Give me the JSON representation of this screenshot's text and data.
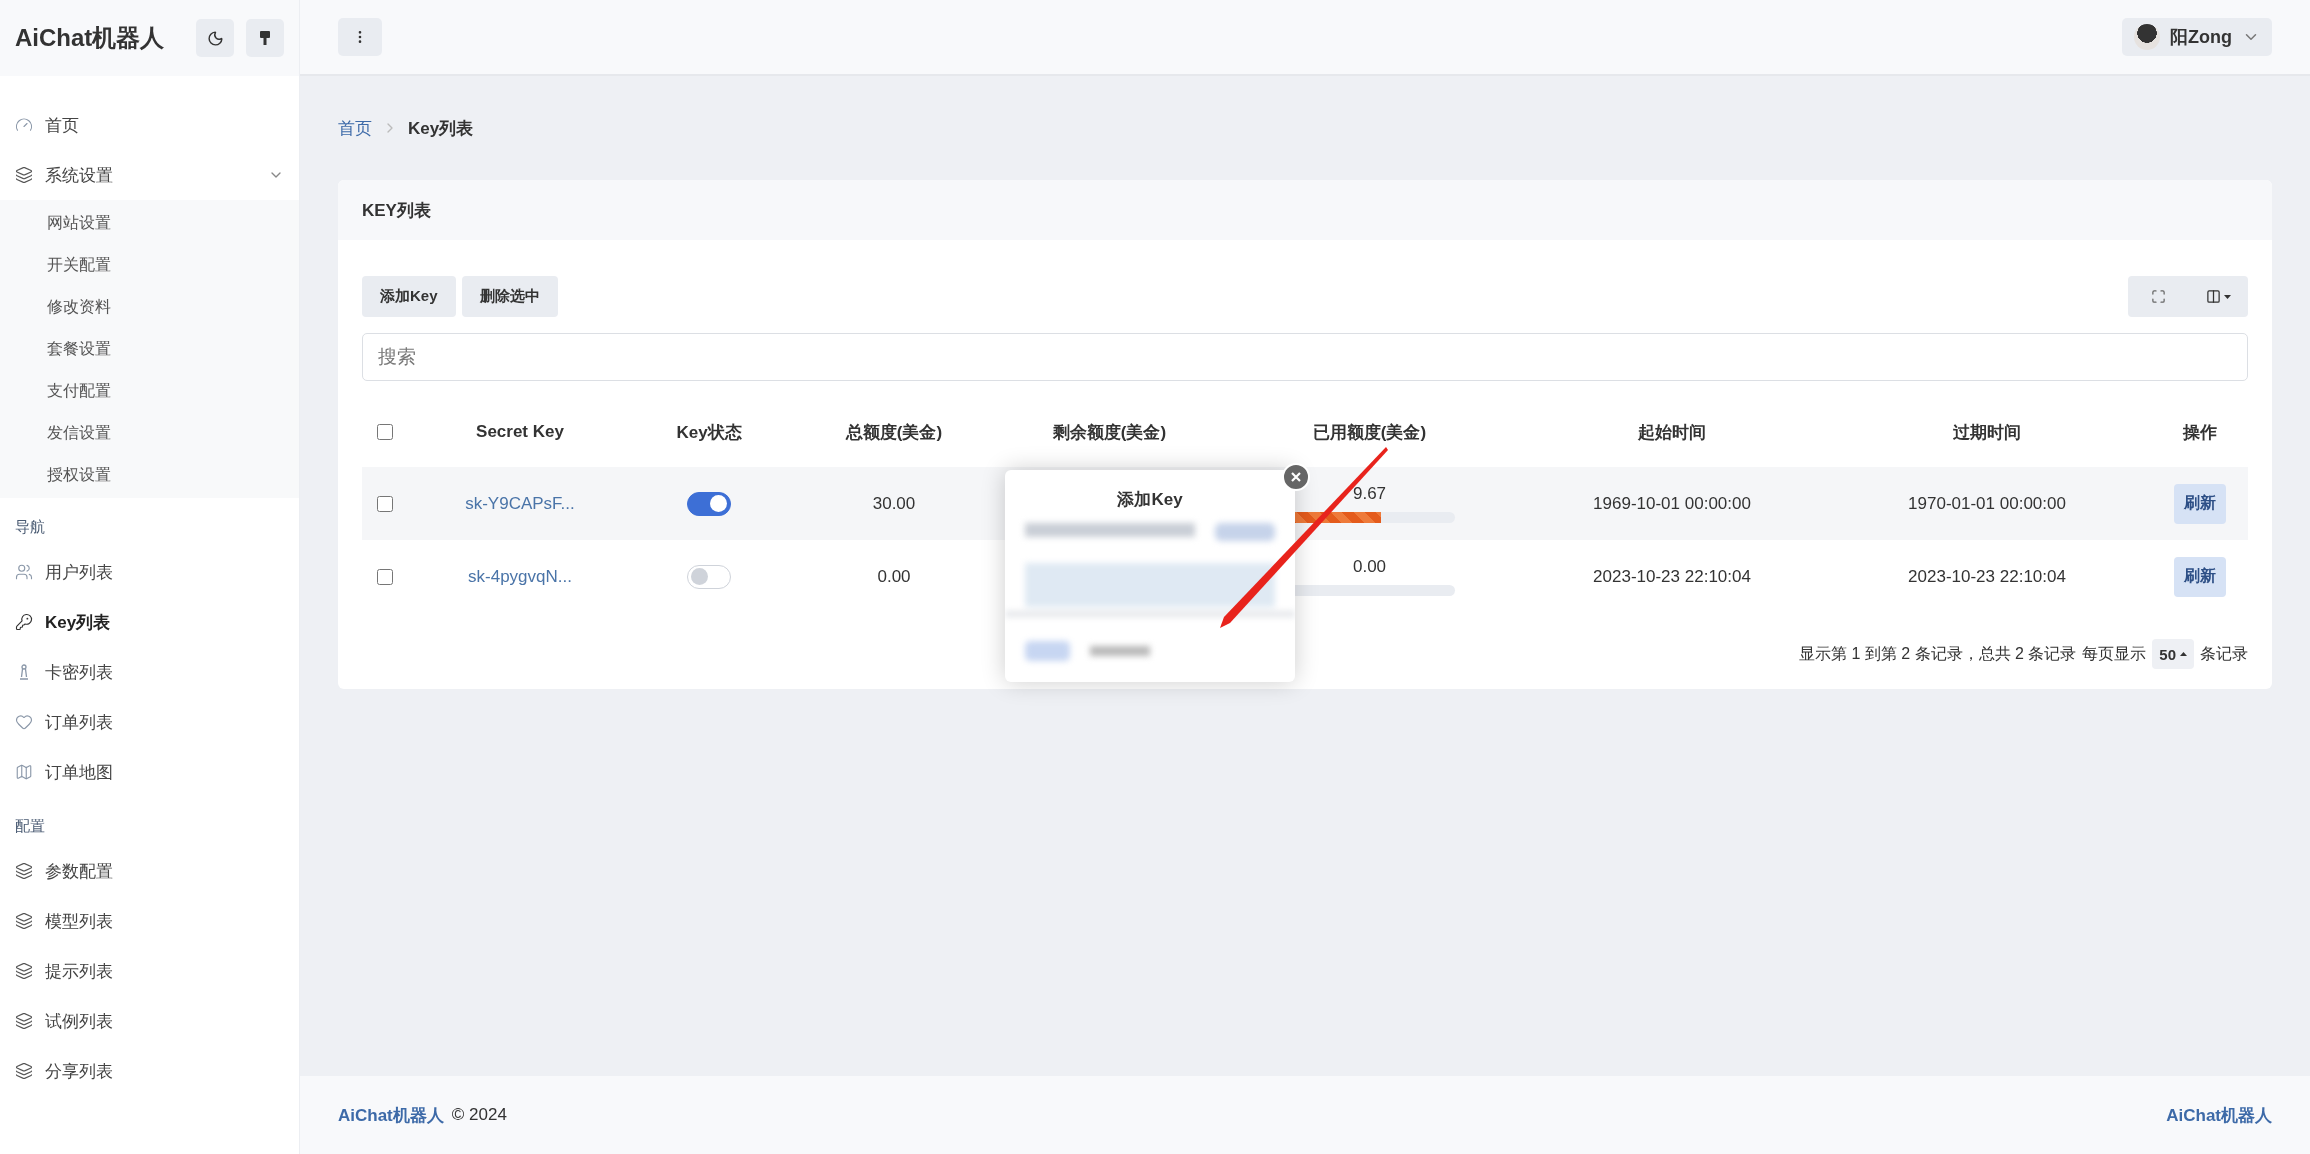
{
  "brand": "AiChat机器人",
  "sidebar": {
    "sections": [
      {
        "items": [
          {
            "label": "首页",
            "kind": "gauge",
            "selected": false
          },
          {
            "label": "系统设置",
            "kind": "layers",
            "selected": false,
            "expanded": true,
            "children": [
              {
                "label": "网站设置",
                "selected": false
              },
              {
                "label": "开关配置",
                "selected": false
              },
              {
                "label": "修改资料",
                "selected": false
              },
              {
                "label": "套餐设置",
                "selected": false
              },
              {
                "label": "支付配置",
                "selected": false
              },
              {
                "label": "发信设置",
                "selected": false
              },
              {
                "label": "授权设置",
                "selected": false
              }
            ]
          }
        ]
      },
      {
        "title": "导航",
        "items": [
          {
            "label": "用户列表",
            "kind": "users",
            "selected": false
          },
          {
            "label": "Key列表",
            "kind": "key",
            "selected": true
          },
          {
            "label": "卡密列表",
            "kind": "pawn",
            "selected": false
          },
          {
            "label": "订单列表",
            "kind": "heart",
            "selected": false
          },
          {
            "label": "订单地图",
            "kind": "map",
            "selected": false
          }
        ]
      },
      {
        "title": "配置",
        "items": [
          {
            "label": "参数配置",
            "kind": "layers",
            "selected": false
          },
          {
            "label": "模型列表",
            "kind": "layers",
            "selected": false
          },
          {
            "label": "提示列表",
            "kind": "layers",
            "selected": false
          },
          {
            "label": "试例列表",
            "kind": "layers",
            "selected": false
          },
          {
            "label": "分享列表",
            "kind": "layers",
            "selected": false
          }
        ]
      }
    ]
  },
  "user": {
    "name": "阳Zong"
  },
  "breadcrumb": [
    {
      "label": "首页",
      "selected": false
    },
    {
      "label": "Key列表",
      "selected": true
    }
  ],
  "card": {
    "title": "KEY列表",
    "buttons": [
      "添加Key",
      "删除选中"
    ],
    "search": {
      "placeholder": "搜索"
    },
    "table": {
      "header_checked": false,
      "columns": [
        "Secret Key",
        "Key状态",
        "总额度(美金)",
        "剩余额度(美金)",
        "已用额度(美金)",
        "起始时间",
        "过期时间",
        "操作"
      ],
      "rows": [
        {
          "checked": false,
          "key": "sk-Y9CAPsF...",
          "on": true,
          "total": "30.00",
          "used": "9.67",
          "level": 0.57,
          "start": "1969-10-01 00:00:00",
          "expire": "1970-01-01 00:00:00",
          "action": "刷新"
        },
        {
          "checked": false,
          "key": "sk-4pygvqN...",
          "on": false,
          "total": "0.00",
          "used": "0.00",
          "start": "2023-10-23 22:10:04",
          "expire": "2023-10-23 22:10:04",
          "action": "刷新"
        }
      ]
    },
    "pagination": {
      "summary": "显示第 1 到第 2 条记录，总共 2 条记录",
      "per_page_label": "每页显示",
      "per_page": "50",
      "unit": "条记录"
    }
  },
  "popup": {
    "title": "添加Key"
  },
  "footer": {
    "brand": "AiChat机器人",
    "copyright": "© 2024",
    "right": "AiChat机器人"
  }
}
